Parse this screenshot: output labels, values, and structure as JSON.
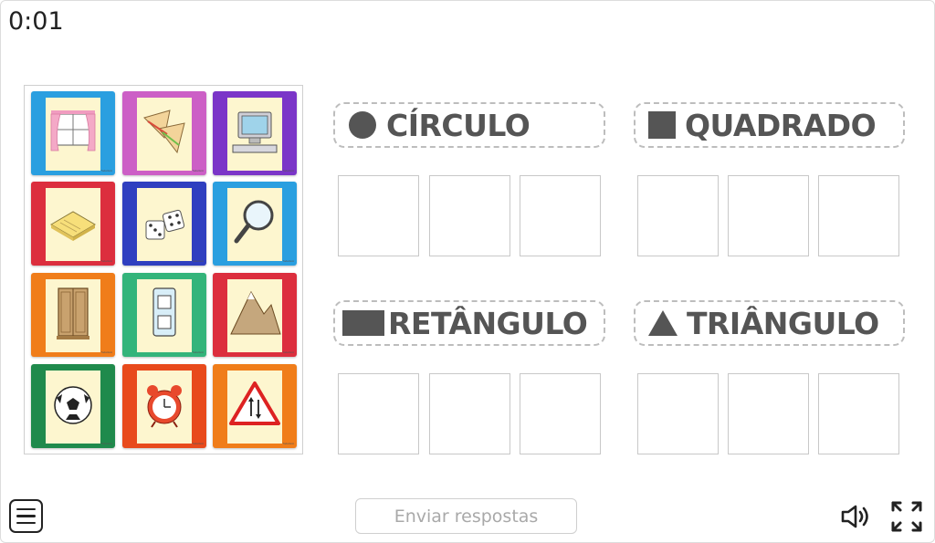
{
  "timer": "0:01",
  "palette": {
    "cards": [
      {
        "name": "window",
        "color": "#2a9fe0",
        "tag": "TodaVeiA"
      },
      {
        "name": "sandwich",
        "color": "#cc5fc6",
        "tag": "TodaVeiA"
      },
      {
        "name": "computer",
        "color": "#7b35c8",
        "tag": "TodaVeiA"
      },
      {
        "name": "notepad",
        "color": "#dc2e3e",
        "tag": "TodaVeiA"
      },
      {
        "name": "dice",
        "color": "#2f3fc0",
        "tag": "TodaVeiA"
      },
      {
        "name": "magnifier",
        "color": "#2a9fe0",
        "tag": "TodaVeiA"
      },
      {
        "name": "wardrobe",
        "color": "#f07d1a",
        "tag": "TodaVeiA"
      },
      {
        "name": "light-switch",
        "color": "#33b47b",
        "tag": "TodaVeiA"
      },
      {
        "name": "mountain",
        "color": "#dc2e3e",
        "tag": "TodaVeiA"
      },
      {
        "name": "soccer-ball",
        "color": "#1f8a4c",
        "tag": "TodaVeiA"
      },
      {
        "name": "alarm-clock",
        "color": "#e84a1c",
        "tag": "TodaVeiA"
      },
      {
        "name": "traffic-sign",
        "color": "#f07d1a",
        "tag": "TodaVeiA"
      }
    ]
  },
  "categories": [
    {
      "label": "CÍRCULO",
      "icon": "circle-icon"
    },
    {
      "label": "QUADRADO",
      "icon": "square-icon"
    },
    {
      "label": "RETÂNGULO",
      "icon": "rectangle-icon"
    },
    {
      "label": "TRIÂNGULO",
      "icon": "triangle-icon"
    }
  ],
  "footer": {
    "submit_label": "Enviar respostas",
    "menu_icon": "menu-icon",
    "sound_icon": "speaker-icon",
    "fullscreen_icon": "fullscreen-icon"
  },
  "colors": {
    "label_text": "#555555",
    "slot_border": "#c8c8c8",
    "card_bg": "#fdf6cf"
  }
}
